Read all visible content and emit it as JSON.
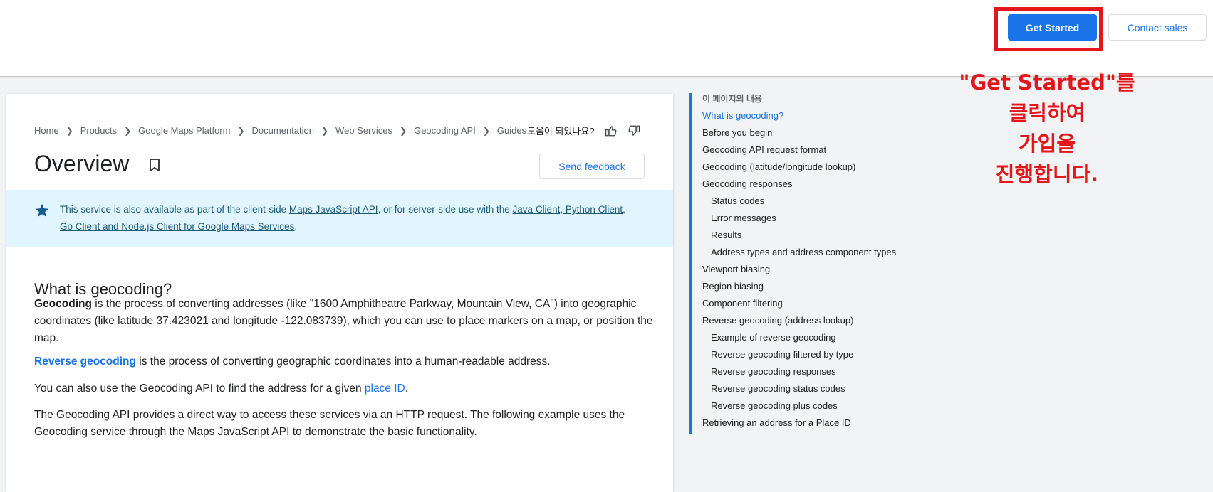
{
  "header": {
    "get_started": "Get Started",
    "contact_sales": "Contact sales"
  },
  "annotation": {
    "line1": "\"Get Started\"를",
    "line2": "클릭하여",
    "line3": "가입을",
    "line4": "진행합니다."
  },
  "breadcrumb": [
    "Home",
    "Products",
    "Google Maps Platform",
    "Documentation",
    "Web Services",
    "Geocoding API",
    "Guides"
  ],
  "helpful": {
    "label": "도움이 되었나요?"
  },
  "page": {
    "title": "Overview",
    "send_feedback": "Send feedback"
  },
  "note": {
    "text1": "This service is also available as part of the client-side ",
    "link1": "Maps JavaScript API",
    "text2": ", or for server-side use with the ",
    "link2": "Java Client, Python Client,",
    "link3": "Go Client and Node.js Client for Google Maps Services",
    "text3": "."
  },
  "section": {
    "heading": "What is geocoding?",
    "p1_bold": "Geocoding",
    "p1_text": " is the process of converting addresses (like \"1600 Amphitheatre Parkway, Mountain View, CA\") into geographic coordinates (like latitude 37.423021 and longitude -122.083739), which you can use to place markers on a map, or position the map.",
    "p2_link": "Reverse geocoding",
    "p2_text": " is the process of converting geographic coordinates into a human-readable address.",
    "p3_text": "You can also use the Geocoding API to find the address for a given ",
    "p3_link": "place ID",
    "p3_end": ".",
    "p4_text": "The Geocoding API provides a direct way to access these services via an HTTP request. The following example uses the Geocoding service through the Maps JavaScript API to demonstrate the basic functionality."
  },
  "toc": {
    "title": "이 페이지의 내용",
    "items": [
      "What is geocoding?",
      "Before you begin",
      "Geocoding API request format",
      "Geocoding (latitude/longitude lookup)",
      "Geocoding responses",
      "Status codes",
      "Error messages",
      "Results",
      "Address types and address component types",
      "Viewport biasing",
      "Region biasing",
      "Component filtering",
      "Reverse geocoding (address lookup)",
      "Example of reverse geocoding",
      "Reverse geocoding filtered by type",
      "Reverse geocoding responses",
      "Reverse geocoding status codes",
      "Reverse geocoding plus codes",
      "Retrieving an address for a Place ID"
    ]
  },
  "colors": {
    "accent": "#1a73e8",
    "annotation": "#e3161b",
    "note_bg": "#e1f5fe"
  }
}
